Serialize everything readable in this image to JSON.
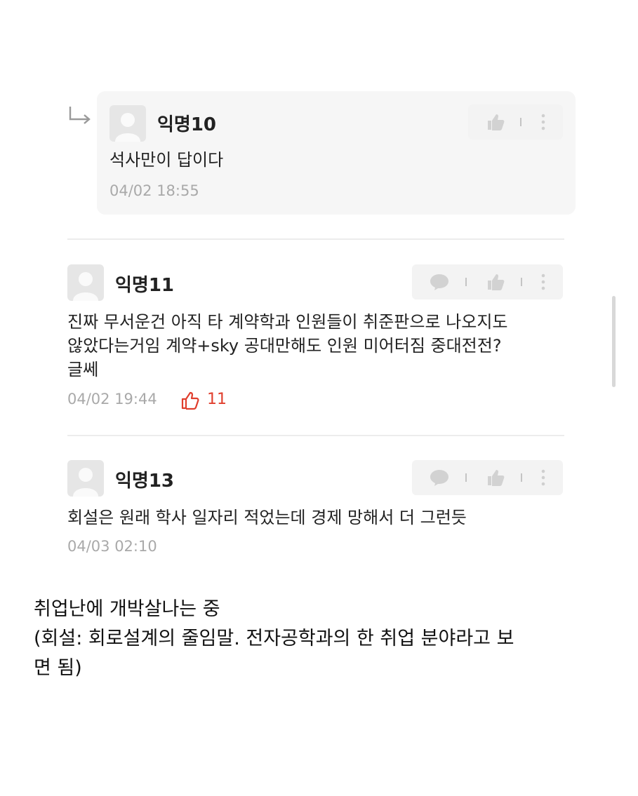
{
  "comments": [
    {
      "author": "익명10",
      "text": "석사만이 답이다",
      "date": "04/02 18:55",
      "is_reply": true
    },
    {
      "author": "익명11",
      "text_lines": [
        "진짜 무서운건 아직 타 계약학과 인원들이 취준판으로 나오지도",
        "않았다는거임 계약+sky 공대만해도 인원 미어터짐 중대전전?",
        "글쎄"
      ],
      "date": "04/02 19:44",
      "likes": "11"
    },
    {
      "author": "익명13",
      "text": "회설은 원래 학사 일자리 적었는데 경제 망해서 더 그런듯",
      "date": "04/03 02:10"
    }
  ],
  "caption": {
    "lines": [
      "취업난에 개박살나는 중",
      "(회설: 회로설계의 줄임말. 전자공학과의 한 취업 분야라고 보",
      "면 됨)"
    ]
  },
  "icons": {
    "reply_arrow": "reply-arrow-icon",
    "avatar": "default-avatar-icon",
    "comment": "comment-bubble-icon",
    "like": "thumbs-up-icon",
    "more": "more-vertical-icon",
    "liked": "thumbs-up-outline-icon"
  },
  "colors": {
    "like_accent": "#e03e2d",
    "meta_gray": "#a9a9a9",
    "card_bg": "#f6f6f6"
  }
}
